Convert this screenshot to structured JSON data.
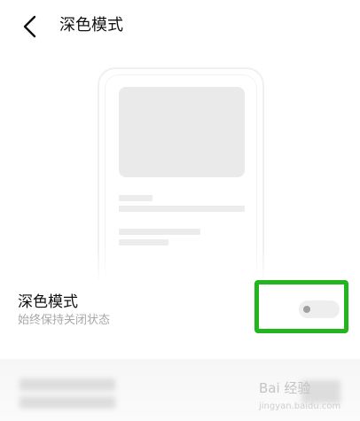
{
  "header": {
    "title": "深色模式",
    "back_icon": "chevron-left-icon"
  },
  "setting": {
    "title": "深色模式",
    "subtitle": "始终保持关闭状态",
    "toggle_on": false
  },
  "watermark": {
    "text": "Bai 经验",
    "sub": "jingyan.baidu.com"
  },
  "colors": {
    "highlight": "#22b51d",
    "toggle_track": "#eeeeee",
    "toggle_knob": "#a0a0a0"
  }
}
